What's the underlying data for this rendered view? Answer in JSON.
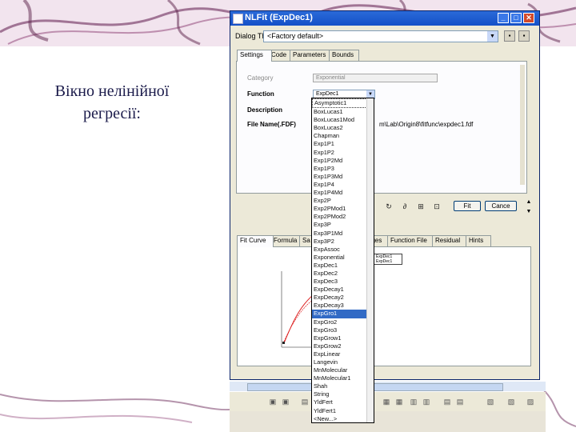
{
  "slide": {
    "caption_line1": "Вікно нелінійної",
    "caption_line2": "регресії:"
  },
  "window": {
    "title": "NLFit (ExpDec1)",
    "dialog_theme_label": "Dialog Theme",
    "dialog_theme_value": "<Factory default>",
    "top_tabs": [
      "Settings",
      "Code",
      "Parameters",
      "Bounds"
    ],
    "active_top_tab": "Settings",
    "fields": {
      "category_label": "Category",
      "category_value": "Exponential",
      "function_label": "Function",
      "function_value": "ExpDec1",
      "description_label": "Description",
      "file_name_label": "File Name(.FDF)",
      "file_name_value": "m\\Lab\\Origin8\\fitfunc\\expdec1.fdf"
    },
    "buttons": {
      "fit": "Fit",
      "cancel": "Cance"
    },
    "bottom_tabs": [
      "Fit Curve",
      "Formula",
      "Sa",
      "ages",
      "Function File",
      "Residual",
      "Hints"
    ],
    "active_bottom_tab": "Fit Curve",
    "plot": {
      "legend_line1": "ExpDec1",
      "legend_line2": "ExpDec1"
    }
  },
  "function_list": {
    "selected": "ExpGro1",
    "items": [
      "Asymptotic1",
      "BoxLucas1",
      "BoxLucas1Mod",
      "BoxLucas2",
      "Chapman",
      "Exp1P1",
      "Exp1P2",
      "Exp1P2Md",
      "Exp1P3",
      "Exp1P3Md",
      "Exp1P4",
      "Exp1P4Md",
      "Exp2P",
      "Exp2PMod1",
      "Exp2PMod2",
      "Exp3P",
      "Exp3P1Md",
      "Exp3P2",
      "ExpAssoc",
      "Exponential",
      "ExpDec1",
      "ExpDec2",
      "ExpDec3",
      "ExpDecay1",
      "ExpDecay2",
      "ExpDecay3",
      "ExpGro1",
      "ExpGro2",
      "ExpGro3",
      "ExpGrow1",
      "ExpGrow2",
      "ExpLinear",
      "Langevin",
      "MnMolecular",
      "MnMolecular1",
      "Shah",
      "String",
      "YldFert",
      "YldFert1",
      "<New...>"
    ]
  },
  "colors": {
    "title_bar": "#1450c8",
    "selection": "#316ac5",
    "slide_text": "#1a1a4a"
  }
}
